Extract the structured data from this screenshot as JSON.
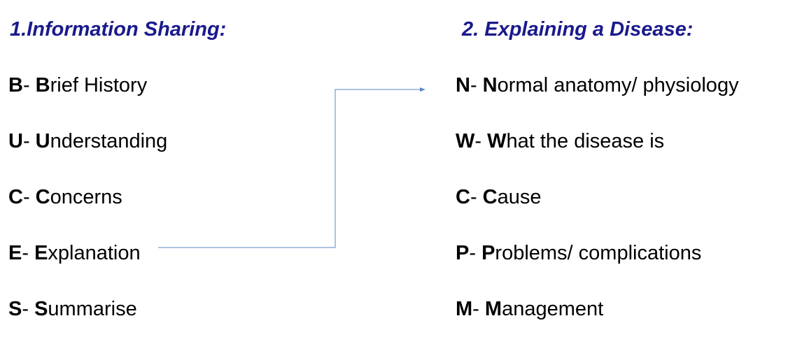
{
  "left": {
    "heading": "1.Information Sharing:",
    "items": [
      {
        "letter": "B",
        "sep": "- ",
        "first": "B",
        "rest": "rief History"
      },
      {
        "letter": "U",
        "sep": "- ",
        "first": "U",
        "rest": "nderstanding"
      },
      {
        "letter": "C",
        "sep": "- ",
        "first": "C",
        "rest": "oncerns"
      },
      {
        "letter": "E",
        "sep": "- ",
        "first": "E",
        "rest": "xplanation"
      },
      {
        "letter": "S",
        "sep": "- ",
        "first": "S",
        "rest": "ummarise"
      }
    ]
  },
  "right": {
    "heading": "2. Explaining a Disease:",
    "items": [
      {
        "letter": "N",
        "sep": "- ",
        "first": "N",
        "rest": "ormal anatomy/ physiology"
      },
      {
        "letter": "W",
        "sep": "- ",
        "first": "W",
        "rest": "hat the disease is"
      },
      {
        "letter": "C",
        "sep": "- ",
        "first": "C",
        "rest": "ause"
      },
      {
        "letter": "P",
        "sep": "- ",
        "first": "P",
        "rest": "roblems/ complications"
      },
      {
        "letter": "M",
        "sep": "- ",
        "first": "M",
        "rest": "anagement"
      }
    ]
  },
  "connector": {
    "from": "E- Explanation",
    "to": "N- Normal anatomy/ physiology",
    "color": "#5b87c0"
  },
  "colors": {
    "heading": "#1a1a8c",
    "text": "#000000"
  }
}
